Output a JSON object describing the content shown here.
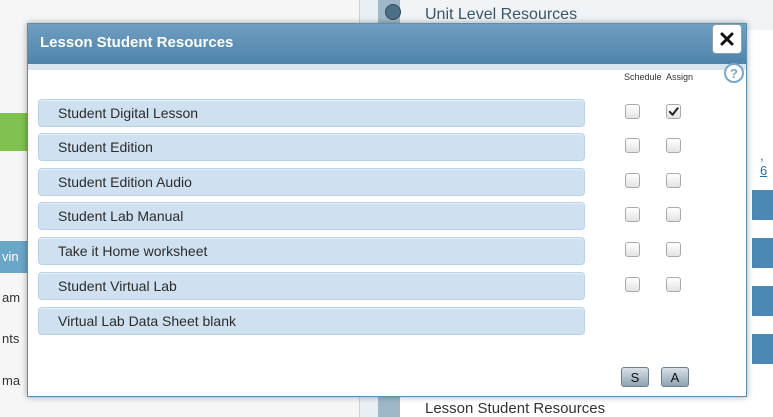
{
  "background": {
    "right_panel_title": "Unit Level Resources",
    "right_panel_footer": "Lesson Student Resources",
    "right_link_fragment": ", 6",
    "left_fragments": [
      "vin",
      "am",
      "nts",
      "ma"
    ]
  },
  "modal": {
    "title": "Lesson Student Resources",
    "columns": {
      "schedule": "Schedule",
      "assign": "Assign"
    },
    "help_glyph": "?",
    "resources": [
      {
        "label": "Student Digital Lesson",
        "schedule": false,
        "assign": true,
        "has_checkboxes": true
      },
      {
        "label": "Student Edition",
        "schedule": false,
        "assign": false,
        "has_checkboxes": true
      },
      {
        "label": "Student Edition Audio",
        "schedule": false,
        "assign": false,
        "has_checkboxes": true
      },
      {
        "label": "Student Lab Manual",
        "schedule": false,
        "assign": false,
        "has_checkboxes": true
      },
      {
        "label": "Take it Home worksheet",
        "schedule": false,
        "assign": false,
        "has_checkboxes": true
      },
      {
        "label": "Student Virtual Lab",
        "schedule": false,
        "assign": false,
        "has_checkboxes": true
      },
      {
        "label": "Virtual Lab Data Sheet blank",
        "schedule": false,
        "assign": false,
        "has_checkboxes": false
      }
    ],
    "footer_buttons": {
      "schedule": "S",
      "assign": "A"
    }
  },
  "colors": {
    "header": "#5a8fb0",
    "row_fill": "#cfe1f1",
    "green_accent": "#7fc24f"
  }
}
